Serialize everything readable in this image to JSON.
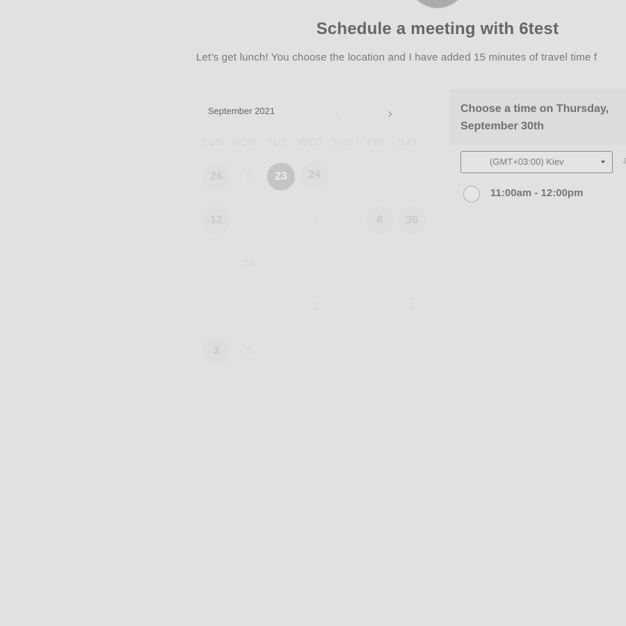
{
  "header": {
    "title": "Schedule a meeting with 6test",
    "description": "Let’s get lunch! You choose the location and I have added 15 minutes of travel time f"
  },
  "calendar": {
    "month_label": "September 2021",
    "prev_glyph": "‹",
    "next_glyph": "›",
    "weekdays": [
      "SUN",
      "MON",
      "TUE",
      "WED",
      "THU",
      "FRI",
      "SAT"
    ],
    "days": {
      "r1_sun": "26",
      "r1_mon": "5",
      "r1_tue": "23",
      "r1_wed": "24",
      "r2_sun": "12",
      "r2_wed": "7",
      "r2_thu": "6",
      "r2_fri": "30",
      "r3_mon": "28",
      "r4_wed": "1",
      "r4_fri": "5",
      "r5_sun": "3",
      "r5_mon": "5"
    }
  },
  "time_panel": {
    "heading": "Choose a time on Thursday, September 30th",
    "timezone": "(GMT+03:00) Kiev",
    "side_letter": "a",
    "slots": [
      {
        "label": "11:00am - 12:00pm"
      }
    ]
  }
}
